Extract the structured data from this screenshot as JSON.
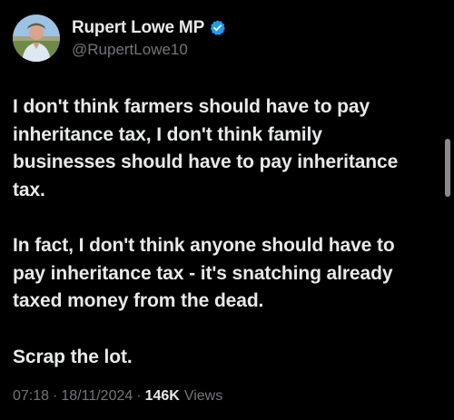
{
  "post": {
    "author": {
      "display_name": "Rupert Lowe MP",
      "handle": "@RupertLowe10",
      "verified": true,
      "verified_color": "#1d9bf0"
    },
    "paragraphs": [
      "I don't think farmers should have to pay inheritance tax, I don't think family businesses should have to pay inheritance tax.",
      "In fact, I don't think anyone should have to pay inheritance tax - it's snatching already taxed money from the dead.",
      "Scrap the lot."
    ],
    "meta": {
      "time": "07:18",
      "date": "18/11/2024",
      "views_count": "146K",
      "views_label": "Views",
      "separator": "·"
    }
  },
  "colors": {
    "background": "#000000",
    "text_primary": "#e7e9ea",
    "text_secondary": "#71767b"
  }
}
